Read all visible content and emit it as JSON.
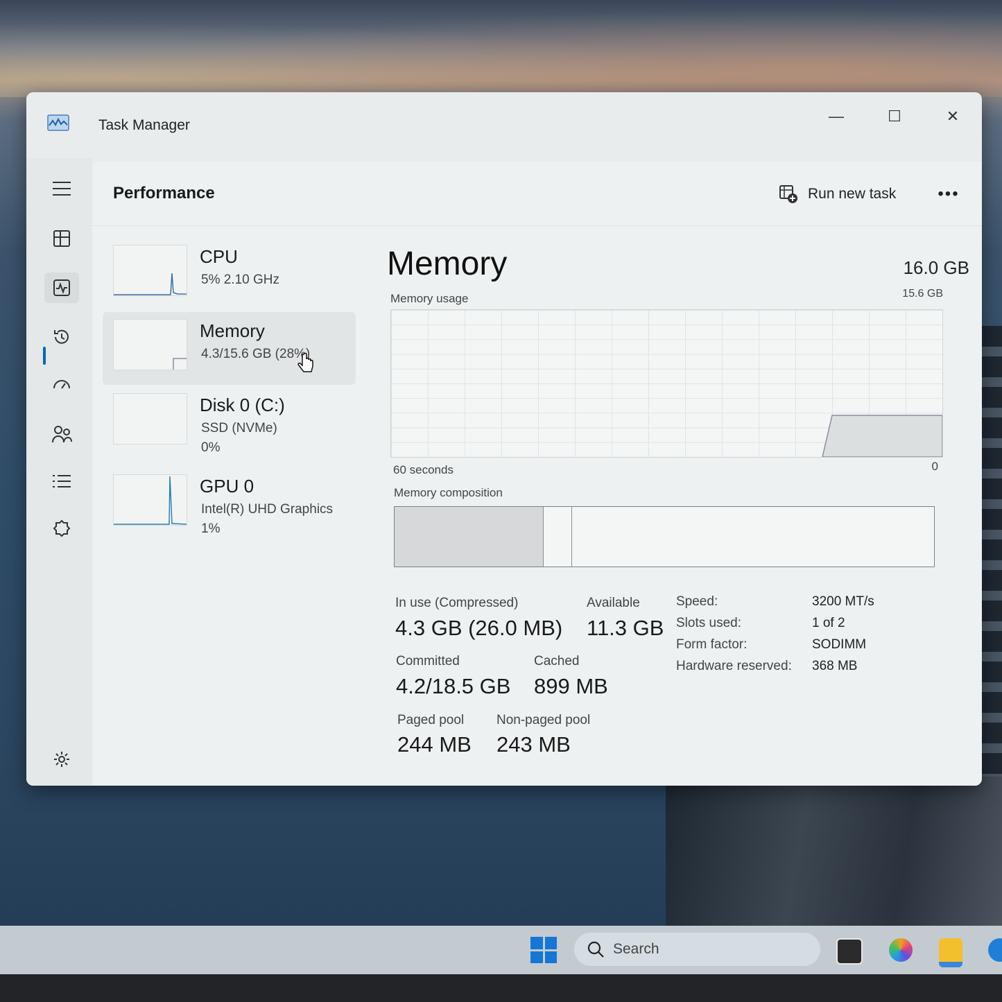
{
  "window": {
    "title": "Task Manager",
    "controls": {
      "minimize": "—",
      "maximize": "☐",
      "close": "✕"
    }
  },
  "header": {
    "page_title": "Performance",
    "run_new_task": "Run new task",
    "more": "•••"
  },
  "nav_rail": {
    "items": [
      {
        "icon": "hamburger-menu-icon"
      },
      {
        "icon": "processes-icon"
      },
      {
        "icon": "performance-icon",
        "active": true
      },
      {
        "icon": "app-history-icon"
      },
      {
        "icon": "startup-apps-icon"
      },
      {
        "icon": "users-icon"
      },
      {
        "icon": "details-icon"
      },
      {
        "icon": "services-icon"
      },
      {
        "icon": "settings-icon"
      }
    ]
  },
  "resources": [
    {
      "name": "CPU",
      "line1": "5%  2.10 GHz",
      "line2": ""
    },
    {
      "name": "Memory",
      "line1": "4.3/15.6 GB (28%)",
      "line2": "",
      "selected": true
    },
    {
      "name": "Disk 0 (C:)",
      "line1": "SSD (NVMe)",
      "line2": "0%"
    },
    {
      "name": "GPU 0",
      "line1": "Intel(R) UHD Graphics",
      "line2": "1%"
    }
  ],
  "memory": {
    "title": "Memory",
    "total": "16.0 GB",
    "usage_label": "Memory usage",
    "usage_max": "15.6 GB",
    "time_label": "60 seconds",
    "zero_label": "0",
    "composition_label": "Memory composition",
    "composition": {
      "in_use_fraction": 0.275,
      "modified_fraction": 0.053
    },
    "stats": {
      "in_use_label": "In use (Compressed)",
      "in_use_value": "4.3 GB (26.0 MB)",
      "available_label": "Available",
      "available_value": "11.3 GB",
      "committed_label": "Committed",
      "committed_value": "4.2/18.5 GB",
      "cached_label": "Cached",
      "cached_value": "899 MB",
      "paged_label": "Paged pool",
      "paged_value": "244 MB",
      "nonpaged_label": "Non-paged pool",
      "nonpaged_value": "243 MB"
    },
    "details": [
      {
        "key": "Speed:",
        "value": "3200 MT/s"
      },
      {
        "key": "Slots used:",
        "value": "1 of 2"
      },
      {
        "key": "Form factor:",
        "value": "SODIMM"
      },
      {
        "key": "Hardware reserved:",
        "value": "368 MB"
      }
    ]
  },
  "taskbar": {
    "search_placeholder": "Search"
  },
  "colors": {
    "accent": "#0067c0",
    "graph_fill": "#dcdfdf",
    "graph_line": "#8a8d9b"
  }
}
